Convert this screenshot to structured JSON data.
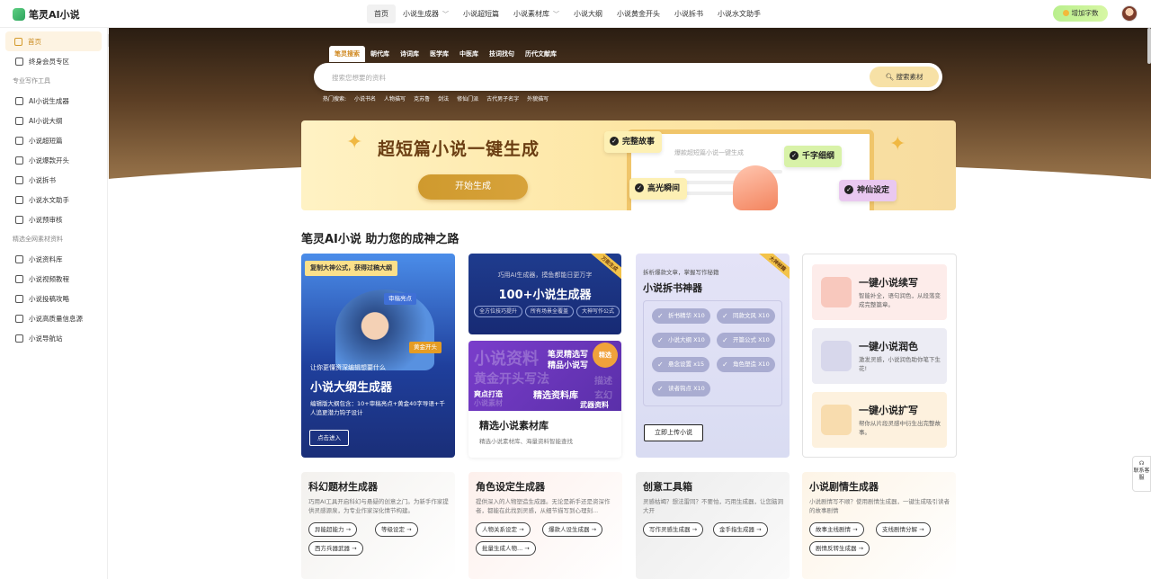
{
  "app": {
    "logo_text": "笔灵AI小说"
  },
  "nav": [
    {
      "label": "首页"
    },
    {
      "label": "小说生成器"
    },
    {
      "label": "小说超短篇"
    },
    {
      "label": "小说素材库"
    },
    {
      "label": "小说大纲"
    },
    {
      "label": "小说黄金开头"
    },
    {
      "label": "小说拆书"
    },
    {
      "label": "小说水文助手"
    }
  ],
  "header": {
    "add_words": "增加字数"
  },
  "sidebar": {
    "home": "首页",
    "vip": "终身会员专区",
    "group1": "专业写作工具",
    "tools": [
      "AI小说生成器",
      "AI小说大纲",
      "小说超短篇",
      "小说爆款开头",
      "小说拆书",
      "小说水文助手",
      "小说预审核"
    ],
    "group2": "精选全网素材资料",
    "resources": [
      "小说资料库",
      "小说视频教程",
      "小说投稿攻略",
      "小说高质量信息源",
      "小说导航站"
    ]
  },
  "search": {
    "tabs": [
      "笔灵搜索",
      "朝代库",
      "诗词库",
      "医学库",
      "中医库",
      "技词找句",
      "历代文献库"
    ],
    "placeholder": "搜索您想要的资料",
    "button": "搜索素材",
    "hot_label": "热门搜索:",
    "hot": [
      "小说书名",
      "人物描写",
      "克苏鲁",
      "剑法",
      "修仙门派",
      "古代男子名字",
      "外貌描写"
    ]
  },
  "banner": {
    "title": "超短篇小说一键生成",
    "button": "开始生成",
    "placeholder": "爆款超短篇小说一键生成",
    "chips": [
      "完整故事",
      "千字细纲",
      "高光瞬间",
      "神仙设定"
    ]
  },
  "section_title": "笔灵AI小说 助力您的成神之路",
  "outline_card": {
    "ribbon": "复制大神公式，获得过稿大纲",
    "label1": "审稿亮点",
    "label2": "黄金开头",
    "sub": "让你更懂资深编辑想要什么",
    "title": "小说大纲生成器",
    "desc": "编辑版大纲包含：10+审稿亮点+黄金40字导语+千人追更潜力钩子设计",
    "button": "点击进入"
  },
  "gen_card": {
    "tag": "万能生成",
    "sub": "巧用AI生成器，摸鱼都能日更万字",
    "title": "100+小说生成器",
    "pills": [
      "全方位技巧提升",
      "所有场景全覆盖",
      "大神写作公式"
    ]
  },
  "material_card": {
    "bg_words": [
      "小说资料",
      "笔灵精选写",
      "精品小说写",
      "黄金开头写法",
      "爽点打造",
      "精选资料库",
      "玄幻",
      "武器资料",
      "描述",
      "小说素材"
    ],
    "badge": "精选",
    "title": "精选小说素材库",
    "desc": "精选小说素材库、海量资料智能查找"
  },
  "split_card": {
    "tag": "大神秘籍",
    "sub": "拆析爆款文章，掌握写作秘籍",
    "title": "小说拆书神器",
    "pills": [
      "折书精华 X10",
      "同款文风 X10",
      "小说大纲 X10",
      "开篇公式 X10",
      "悬念设置 x15",
      "角色塑造 X10",
      "读者钩点 X10"
    ],
    "button": "立即上传小说"
  },
  "quick_tools": [
    {
      "title": "一键小说续写",
      "desc": "智能补全，语句润色，从段落变成完整篇章。"
    },
    {
      "title": "一键小说润色",
      "desc": "激发灵感，小说润色助你笔下生花!"
    },
    {
      "title": "一键小说扩写",
      "desc": "帮你从片段灵感中衍生出完整故事。"
    }
  ],
  "bottom_cards": [
    {
      "title": "科幻题材生成器",
      "desc": "巧用AI工具开启科幻与悬疑的创意之门。为新手作家提供灵感源泉，为专业作家深化情节构建。",
      "buttons": [
        "异能超能力",
        "等级设定",
        "西方兵器武器"
      ]
    },
    {
      "title": "角色设定生成器",
      "desc": "提供深入的人物塑造生成器。无论是新手还是资深作者，都能在此找到灵感，从细节描写到心理刻...",
      "buttons": [
        "人物关系设定",
        "爆款人设生成器",
        "批量生成人物..."
      ]
    },
    {
      "title": "创意工具箱",
      "desc": "灵感枯竭？想法雷同？不要怕，巧用生成器，让您脑洞大开",
      "buttons": [
        "写作灵感生成器",
        "金手指生成器"
      ]
    },
    {
      "title": "小说剧情生成器",
      "desc": "小说剧情写不顺？使用剧情生成器，一键生成吸引读者的故事剧情",
      "buttons": [
        "故事主线剧情",
        "支线剧情分解",
        "剧情反转生成器"
      ]
    }
  ],
  "float": {
    "contact": "联系客服"
  }
}
